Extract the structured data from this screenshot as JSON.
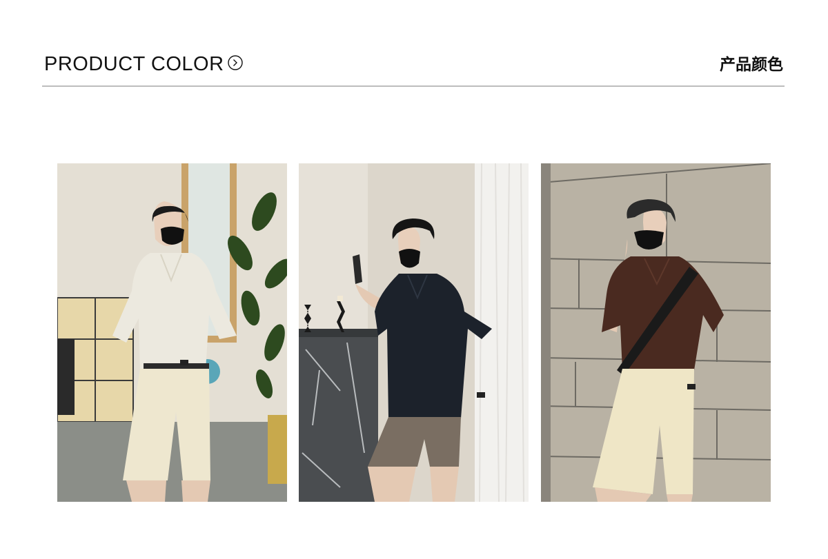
{
  "header": {
    "title": "PRODUCT COLOR",
    "title_cn": "产品颜色",
    "arrow_icon": "circle-chevron-right-icon"
  },
  "photos": [
    {
      "shirt_color": "#ece9df",
      "shorts_color": "#eee7cf",
      "background": "#e6e1d6"
    },
    {
      "shirt_color": "#1c222b",
      "shorts_color": "#7a6e62",
      "background": "#dcd6cb"
    },
    {
      "shirt_color": "#4a2a20",
      "shorts_color": "#efe6c6",
      "background": "#b9b2a4"
    }
  ]
}
